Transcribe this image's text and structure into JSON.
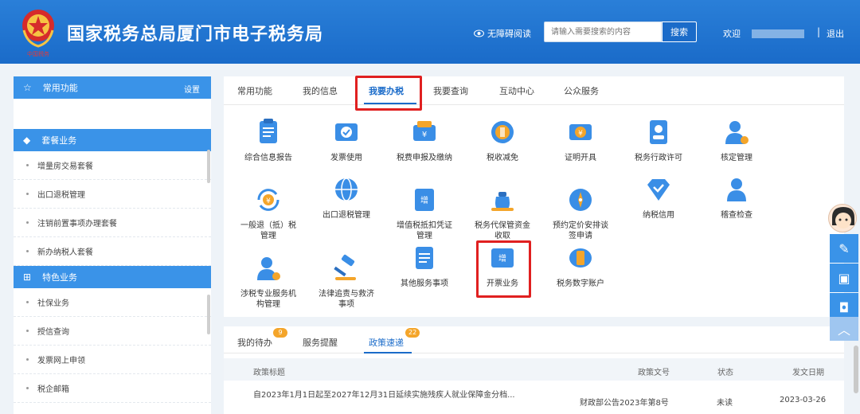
{
  "header": {
    "site_title": "国家税务总局厦门市电子税务局",
    "accessibility": "无障碍阅读",
    "search_placeholder": "请输入需要搜索的内容",
    "search_button": "搜索",
    "welcome": "欢迎",
    "separator": "|",
    "logout": "退出",
    "emblem_text": "中国税务"
  },
  "sidebar": {
    "common_title": "常用功能",
    "settings": "设置",
    "package_title": "套餐业务",
    "package_items": [
      "增量房交易套餐",
      "出口退税管理",
      "注销前置事项办理套餐",
      "新办纳税人套餐"
    ],
    "special_title": "特色业务",
    "special_items": [
      "社保业务",
      "授信查询",
      "发票网上申领",
      "税企邮箱"
    ]
  },
  "main_tabs": [
    "常用功能",
    "我的信息",
    "我要办税",
    "我要查询",
    "互动中心",
    "公众服务"
  ],
  "services": {
    "row1": [
      "综合信息报告",
      "发票使用",
      "税费申报及缴纳",
      "税收减免",
      "证明开具",
      "税务行政许可",
      "核定管理"
    ],
    "row2": [
      "一般退（抵）税\n管理",
      "出口退税管理",
      "增值税抵扣凭证\n管理",
      "税务代保管资金\n收取",
      "预约定价安排谈\n签申请",
      "纳税信用",
      "稽查检查"
    ],
    "row3": [
      "涉税专业服务机\n构管理",
      "法律追责与救济\n事项",
      "其他服务事项",
      "开票业务",
      "税务数字账户"
    ]
  },
  "bottom_tabs": {
    "todo": "我的待办",
    "todo_count": "9",
    "reminders": "服务提醒",
    "policy": "政策速递",
    "policy_count": "22"
  },
  "policy_table": {
    "headers": [
      "政策标题",
      "政策文号",
      "状态",
      "发文日期"
    ],
    "rows": [
      {
        "title": "自2023年1月1日起至2027年12月31日延续实施残疾人就业保障金分档...",
        "doc_no": "财政部公告2023年第8号",
        "status": "未读",
        "date": "2023-03-26"
      }
    ]
  }
}
